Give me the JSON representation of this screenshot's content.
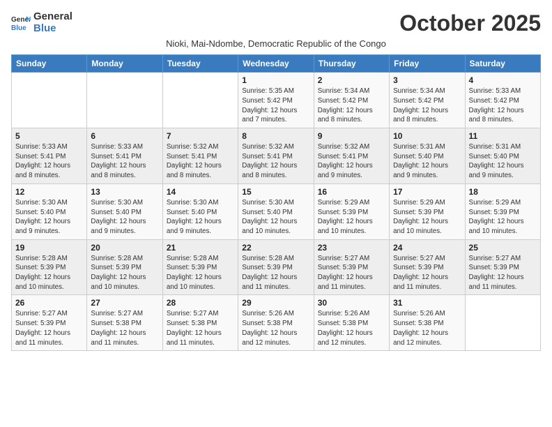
{
  "logo": {
    "general": "General",
    "blue": "Blue"
  },
  "title": "October 2025",
  "subtitle": "Nioki, Mai-Ndombe, Democratic Republic of the Congo",
  "days_header": [
    "Sunday",
    "Monday",
    "Tuesday",
    "Wednesday",
    "Thursday",
    "Friday",
    "Saturday"
  ],
  "weeks": [
    [
      {
        "day": "",
        "sunrise": "",
        "sunset": "",
        "daylight": ""
      },
      {
        "day": "",
        "sunrise": "",
        "sunset": "",
        "daylight": ""
      },
      {
        "day": "",
        "sunrise": "",
        "sunset": "",
        "daylight": ""
      },
      {
        "day": "1",
        "sunrise": "Sunrise: 5:35 AM",
        "sunset": "Sunset: 5:42 PM",
        "daylight": "Daylight: 12 hours and 7 minutes."
      },
      {
        "day": "2",
        "sunrise": "Sunrise: 5:34 AM",
        "sunset": "Sunset: 5:42 PM",
        "daylight": "Daylight: 12 hours and 8 minutes."
      },
      {
        "day": "3",
        "sunrise": "Sunrise: 5:34 AM",
        "sunset": "Sunset: 5:42 PM",
        "daylight": "Daylight: 12 hours and 8 minutes."
      },
      {
        "day": "4",
        "sunrise": "Sunrise: 5:33 AM",
        "sunset": "Sunset: 5:42 PM",
        "daylight": "Daylight: 12 hours and 8 minutes."
      }
    ],
    [
      {
        "day": "5",
        "sunrise": "Sunrise: 5:33 AM",
        "sunset": "Sunset: 5:41 PM",
        "daylight": "Daylight: 12 hours and 8 minutes."
      },
      {
        "day": "6",
        "sunrise": "Sunrise: 5:33 AM",
        "sunset": "Sunset: 5:41 PM",
        "daylight": "Daylight: 12 hours and 8 minutes."
      },
      {
        "day": "7",
        "sunrise": "Sunrise: 5:32 AM",
        "sunset": "Sunset: 5:41 PM",
        "daylight": "Daylight: 12 hours and 8 minutes."
      },
      {
        "day": "8",
        "sunrise": "Sunrise: 5:32 AM",
        "sunset": "Sunset: 5:41 PM",
        "daylight": "Daylight: 12 hours and 8 minutes."
      },
      {
        "day": "9",
        "sunrise": "Sunrise: 5:32 AM",
        "sunset": "Sunset: 5:41 PM",
        "daylight": "Daylight: 12 hours and 9 minutes."
      },
      {
        "day": "10",
        "sunrise": "Sunrise: 5:31 AM",
        "sunset": "Sunset: 5:40 PM",
        "daylight": "Daylight: 12 hours and 9 minutes."
      },
      {
        "day": "11",
        "sunrise": "Sunrise: 5:31 AM",
        "sunset": "Sunset: 5:40 PM",
        "daylight": "Daylight: 12 hours and 9 minutes."
      }
    ],
    [
      {
        "day": "12",
        "sunrise": "Sunrise: 5:30 AM",
        "sunset": "Sunset: 5:40 PM",
        "daylight": "Daylight: 12 hours and 9 minutes."
      },
      {
        "day": "13",
        "sunrise": "Sunrise: 5:30 AM",
        "sunset": "Sunset: 5:40 PM",
        "daylight": "Daylight: 12 hours and 9 minutes."
      },
      {
        "day": "14",
        "sunrise": "Sunrise: 5:30 AM",
        "sunset": "Sunset: 5:40 PM",
        "daylight": "Daylight: 12 hours and 9 minutes."
      },
      {
        "day": "15",
        "sunrise": "Sunrise: 5:30 AM",
        "sunset": "Sunset: 5:40 PM",
        "daylight": "Daylight: 12 hours and 10 minutes."
      },
      {
        "day": "16",
        "sunrise": "Sunrise: 5:29 AM",
        "sunset": "Sunset: 5:39 PM",
        "daylight": "Daylight: 12 hours and 10 minutes."
      },
      {
        "day": "17",
        "sunrise": "Sunrise: 5:29 AM",
        "sunset": "Sunset: 5:39 PM",
        "daylight": "Daylight: 12 hours and 10 minutes."
      },
      {
        "day": "18",
        "sunrise": "Sunrise: 5:29 AM",
        "sunset": "Sunset: 5:39 PM",
        "daylight": "Daylight: 12 hours and 10 minutes."
      }
    ],
    [
      {
        "day": "19",
        "sunrise": "Sunrise: 5:28 AM",
        "sunset": "Sunset: 5:39 PM",
        "daylight": "Daylight: 12 hours and 10 minutes."
      },
      {
        "day": "20",
        "sunrise": "Sunrise: 5:28 AM",
        "sunset": "Sunset: 5:39 PM",
        "daylight": "Daylight: 12 hours and 10 minutes."
      },
      {
        "day": "21",
        "sunrise": "Sunrise: 5:28 AM",
        "sunset": "Sunset: 5:39 PM",
        "daylight": "Daylight: 12 hours and 10 minutes."
      },
      {
        "day": "22",
        "sunrise": "Sunrise: 5:28 AM",
        "sunset": "Sunset: 5:39 PM",
        "daylight": "Daylight: 12 hours and 11 minutes."
      },
      {
        "day": "23",
        "sunrise": "Sunrise: 5:27 AM",
        "sunset": "Sunset: 5:39 PM",
        "daylight": "Daylight: 12 hours and 11 minutes."
      },
      {
        "day": "24",
        "sunrise": "Sunrise: 5:27 AM",
        "sunset": "Sunset: 5:39 PM",
        "daylight": "Daylight: 12 hours and 11 minutes."
      },
      {
        "day": "25",
        "sunrise": "Sunrise: 5:27 AM",
        "sunset": "Sunset: 5:39 PM",
        "daylight": "Daylight: 12 hours and 11 minutes."
      }
    ],
    [
      {
        "day": "26",
        "sunrise": "Sunrise: 5:27 AM",
        "sunset": "Sunset: 5:39 PM",
        "daylight": "Daylight: 12 hours and 11 minutes."
      },
      {
        "day": "27",
        "sunrise": "Sunrise: 5:27 AM",
        "sunset": "Sunset: 5:38 PM",
        "daylight": "Daylight: 12 hours and 11 minutes."
      },
      {
        "day": "28",
        "sunrise": "Sunrise: 5:27 AM",
        "sunset": "Sunset: 5:38 PM",
        "daylight": "Daylight: 12 hours and 11 minutes."
      },
      {
        "day": "29",
        "sunrise": "Sunrise: 5:26 AM",
        "sunset": "Sunset: 5:38 PM",
        "daylight": "Daylight: 12 hours and 12 minutes."
      },
      {
        "day": "30",
        "sunrise": "Sunrise: 5:26 AM",
        "sunset": "Sunset: 5:38 PM",
        "daylight": "Daylight: 12 hours and 12 minutes."
      },
      {
        "day": "31",
        "sunrise": "Sunrise: 5:26 AM",
        "sunset": "Sunset: 5:38 PM",
        "daylight": "Daylight: 12 hours and 12 minutes."
      },
      {
        "day": "",
        "sunrise": "",
        "sunset": "",
        "daylight": ""
      }
    ]
  ]
}
